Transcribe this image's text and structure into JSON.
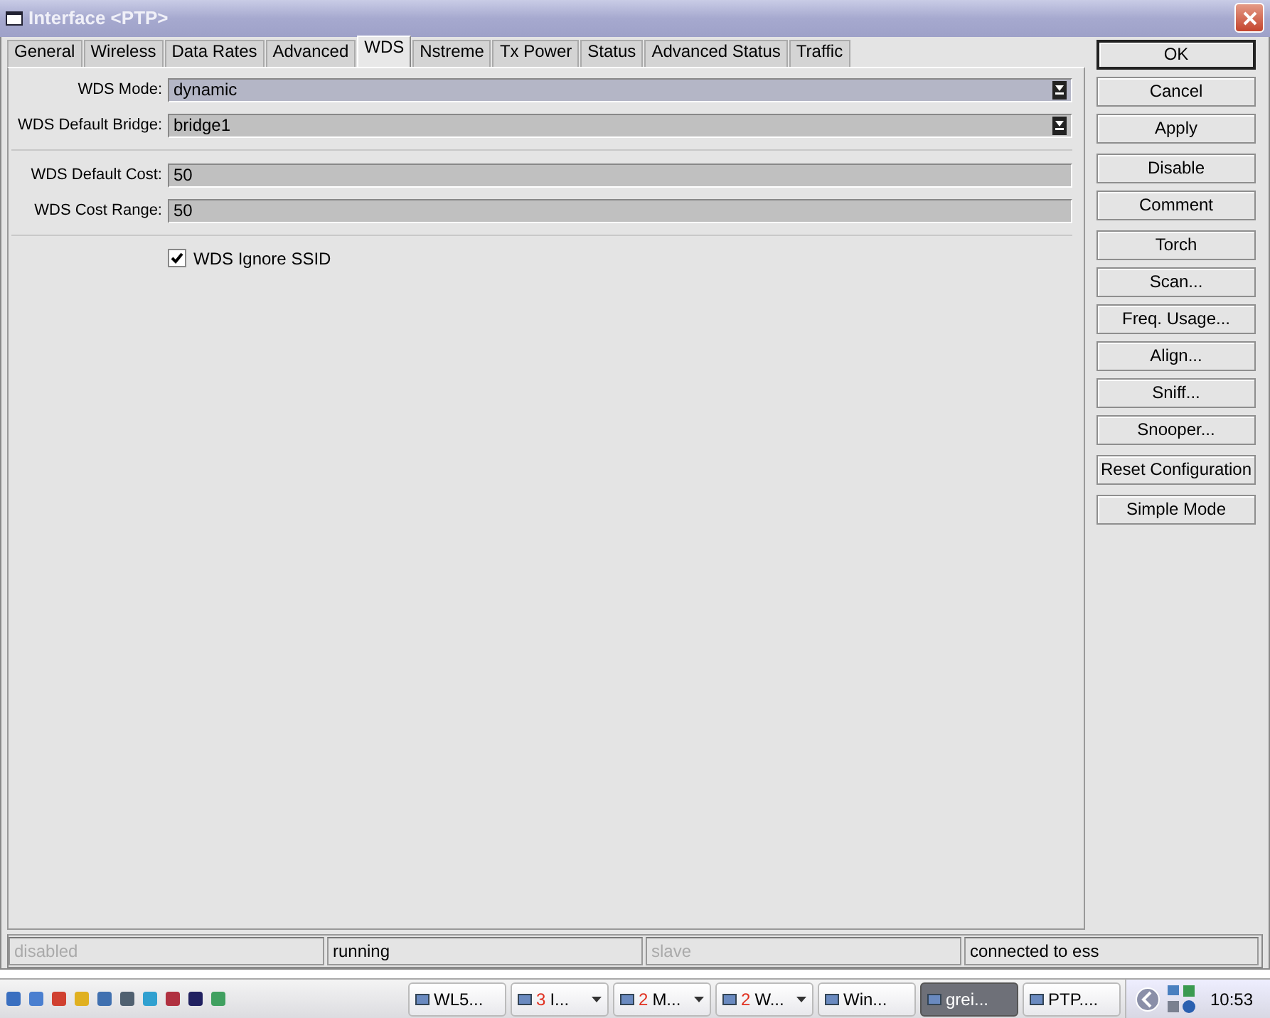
{
  "window": {
    "title": "Interface <PTP>"
  },
  "tabs": [
    {
      "label": "General",
      "selected": false
    },
    {
      "label": "Wireless",
      "selected": false
    },
    {
      "label": "Data Rates",
      "selected": false
    },
    {
      "label": "Advanced",
      "selected": false
    },
    {
      "label": "WDS",
      "selected": true
    },
    {
      "label": "Nstreme",
      "selected": false
    },
    {
      "label": "Tx Power",
      "selected": false
    },
    {
      "label": "Status",
      "selected": false
    },
    {
      "label": "Advanced Status",
      "selected": false
    },
    {
      "label": "Traffic",
      "selected": false
    }
  ],
  "form_groups": [
    [
      {
        "kind": "dropdown",
        "label": "WDS Mode:",
        "value": "dynamic",
        "selected": true
      },
      {
        "kind": "dropdown",
        "label": "WDS Default Bridge:",
        "value": "bridge1",
        "selected": false
      }
    ],
    [
      {
        "kind": "text",
        "label": "WDS Default Cost:",
        "value": "50"
      },
      {
        "kind": "text",
        "label": "WDS Cost Range:",
        "value": "50"
      }
    ],
    [
      {
        "kind": "checkbox",
        "label": "WDS Ignore SSID",
        "checked": true
      }
    ]
  ],
  "button_groups": [
    [
      {
        "label": "OK",
        "default": true
      },
      {
        "label": "Cancel",
        "default": false
      },
      {
        "label": "Apply",
        "default": false
      }
    ],
    [
      {
        "label": "Disable",
        "default": false
      },
      {
        "label": "Comment",
        "default": false
      }
    ],
    [
      {
        "label": "Torch",
        "default": false
      },
      {
        "label": "Scan...",
        "default": false
      },
      {
        "label": "Freq. Usage...",
        "default": false
      },
      {
        "label": "Align...",
        "default": false
      },
      {
        "label": "Sniff...",
        "default": false
      },
      {
        "label": "Snooper...",
        "default": false
      }
    ],
    [
      {
        "label": "Reset Configuration",
        "default": false
      }
    ],
    [
      {
        "label": "Simple Mode",
        "default": false
      }
    ]
  ],
  "status_bar": [
    {
      "text": "disabled",
      "dimmed": true
    },
    {
      "text": "running",
      "dimmed": false
    },
    {
      "text": "slave",
      "dimmed": true
    },
    {
      "text": "connected to ess",
      "dimmed": false
    }
  ],
  "taskbar": {
    "buttons": [
      {
        "label": "WL5...",
        "grouped": false,
        "selected": false
      },
      {
        "count": "3",
        "label": "I...",
        "grouped": true,
        "selected": false
      },
      {
        "count": "2",
        "label": "M...",
        "grouped": true,
        "selected": false
      },
      {
        "count": "2",
        "label": "W...",
        "grouped": true,
        "selected": false
      },
      {
        "label": "Win...",
        "grouped": false,
        "selected": false
      },
      {
        "label": "grei...",
        "grouped": false,
        "selected": true
      },
      {
        "label": "PTP....",
        "grouped": false,
        "selected": false
      }
    ],
    "clock": "10:53"
  }
}
